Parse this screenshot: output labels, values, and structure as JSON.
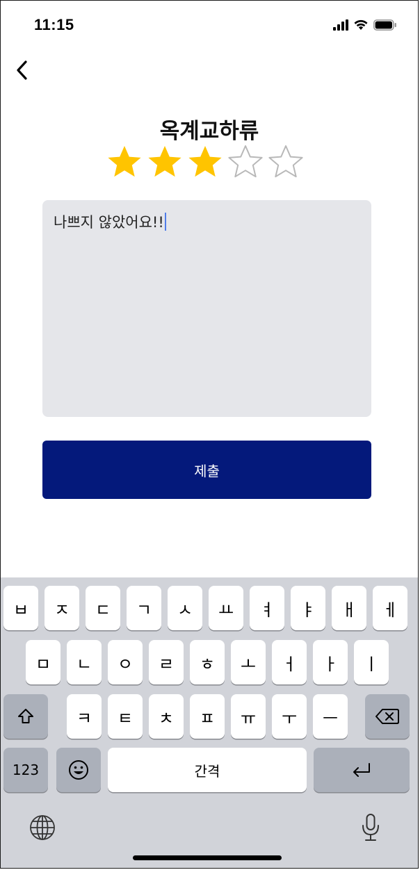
{
  "status_bar": {
    "time": "11:15",
    "icons": [
      "signal-icon",
      "wifi-icon",
      "battery-icon"
    ]
  },
  "nav": {
    "back_icon": "chevron-left-icon"
  },
  "product": {
    "title": "옥계교하류"
  },
  "rating": {
    "value": 3,
    "max": 5,
    "filled_color": "#ffc400",
    "empty_color": "#b8b8b8"
  },
  "review": {
    "text": "나쁘지 않았어요!!",
    "background": "#e5e6ea"
  },
  "submit": {
    "label": "제출",
    "background": "#04197b"
  },
  "keyboard": {
    "row1": [
      "ㅂ",
      "ㅈ",
      "ㄷ",
      "ㄱ",
      "ㅅ",
      "ㅛ",
      "ㅕ",
      "ㅑ",
      "ㅐ",
      "ㅔ"
    ],
    "row2": [
      "ㅁ",
      "ㄴ",
      "ㅇ",
      "ㄹ",
      "ㅎ",
      "ㅗ",
      "ㅓ",
      "ㅏ",
      "ㅣ"
    ],
    "row3": [
      "ㅋ",
      "ㅌ",
      "ㅊ",
      "ㅍ",
      "ㅠ",
      "ㅜ",
      "ㅡ"
    ],
    "numbers_label": "123",
    "space_label": "간격",
    "shift_icon": "shift-icon",
    "delete_icon": "delete-icon",
    "emoji_icon": "emoji-icon",
    "return_icon": "return-icon",
    "globe_icon": "globe-icon",
    "mic_icon": "microphone-icon"
  }
}
